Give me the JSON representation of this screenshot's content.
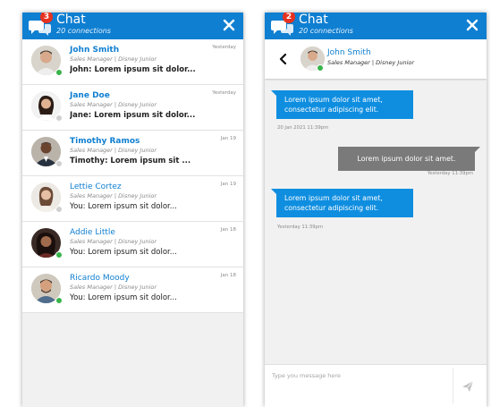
{
  "chat": {
    "title": "Chat",
    "subtitle": "20 connections",
    "badge": "3",
    "right_badge": "2"
  },
  "conversations": [
    {
      "name": "John Smith",
      "role": "Sales Manager | Disney Junior",
      "preview": "John: Lorem ipsum sit dolor...",
      "time": "Yesterday",
      "unread": true,
      "status": "online"
    },
    {
      "name": "Jane Doe",
      "role": "Sales Manager | Disney Junior",
      "preview": "Jane: Lorem ipsum sit dolor...",
      "time": "Yesterday",
      "unread": true,
      "status": "offline"
    },
    {
      "name": "Timothy Ramos",
      "role": "Sales Manager | Disney Junior",
      "preview": "Timothy: Lorem ipsum sit ...",
      "time": "Jan 19",
      "unread": true,
      "status": "offline"
    },
    {
      "name": "Lettie Cortez",
      "role": "Sales Manager | Disney Junior",
      "preview": "You: Lorem ipsum sit dolor...",
      "time": "Jan 19",
      "unread": false,
      "status": "offline"
    },
    {
      "name": "Addie Little",
      "role": "Sales Manager | Disney Junior",
      "preview": "You: Lorem ipsum sit dolor...",
      "time": "Jan 18",
      "unread": false,
      "status": "online"
    },
    {
      "name": "Ricardo Moody",
      "role": "Sales Manager | Disney Junior",
      "preview": "You: Lorem ipsum sit dolor...",
      "time": "Jan 18",
      "unread": false,
      "status": "online"
    }
  ],
  "thread": {
    "contact_name": "John Smith",
    "contact_role": "Sales Manager | Disney Junior",
    "messages": [
      {
        "direction": "in",
        "text_line1": "Lorem ipsum dolor sit amet,",
        "text_line2": "consectetur adipiscing elit.",
        "time": "20 Jan 2021 11:39pm"
      },
      {
        "direction": "out",
        "text_line1": "Lorem ipsum dolor sit amet.",
        "text_line2": "",
        "time": "Yesterday 11:39pm"
      },
      {
        "direction": "in",
        "text_line1": "Lorem ipsum dolor sit amet,",
        "text_line2": "consectetur adipiscing elit.",
        "time": "Yesterday 11:39pm"
      }
    ],
    "composer_placeholder": "Type you message here"
  },
  "colors": {
    "brand": "#0f7fd1",
    "incoming_bubble": "#0f8ee0",
    "outgoing_bubble": "#7a7a7a",
    "badge": "#e6321f",
    "online": "#38b44a"
  },
  "icons": {
    "header": "chat-bubbles-icon",
    "close": "close-icon",
    "back": "chevron-left-icon",
    "send": "send-icon"
  }
}
